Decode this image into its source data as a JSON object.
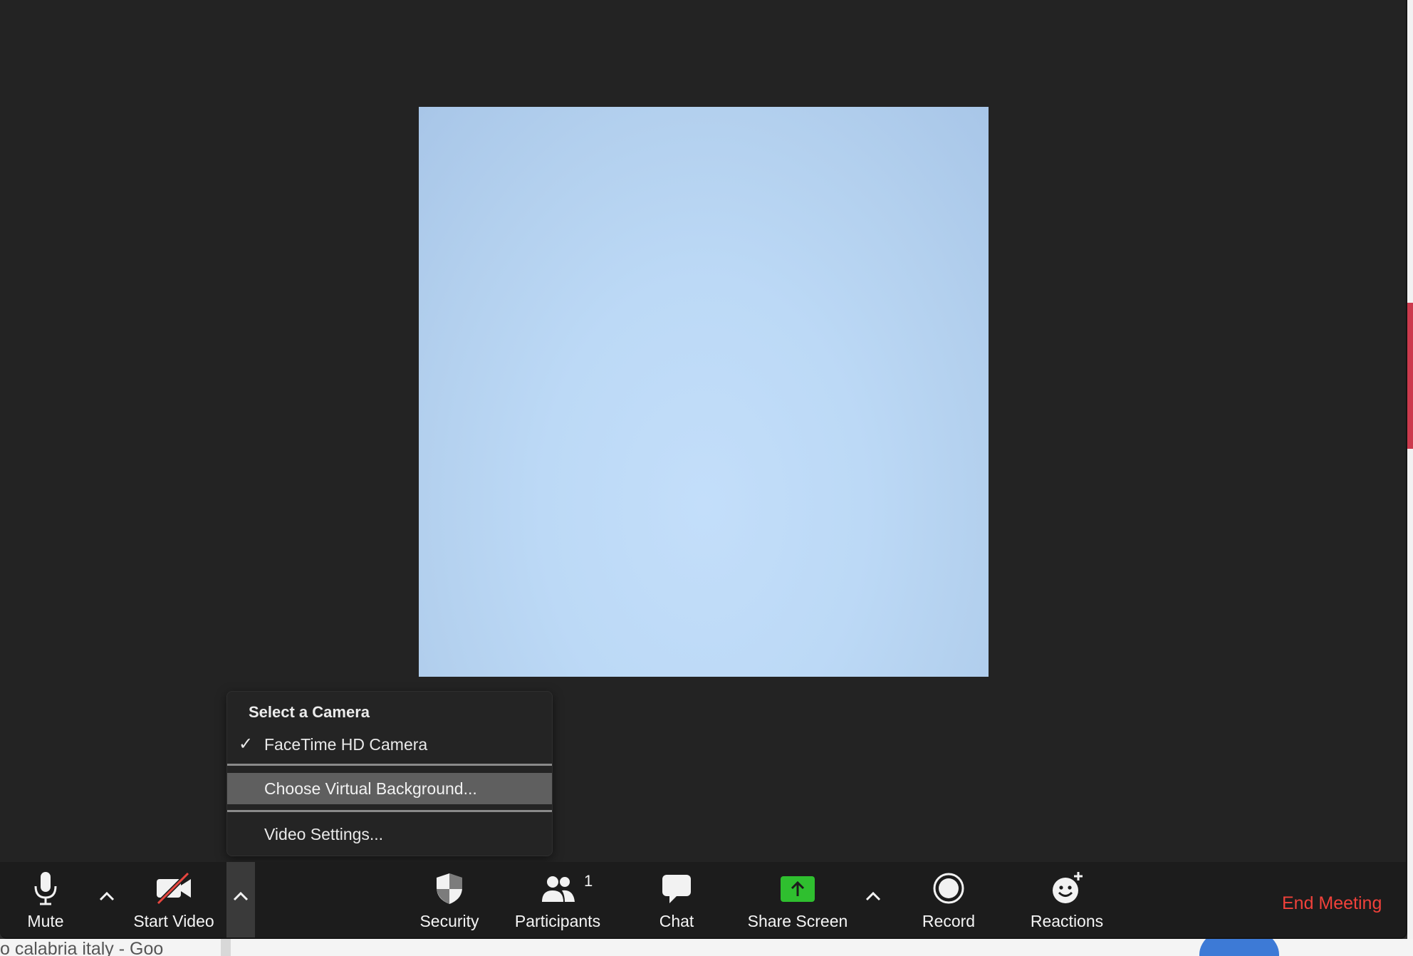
{
  "camera_menu": {
    "heading": "Select a Camera",
    "selected_check": "✓",
    "camera_name": "FaceTime HD Camera",
    "virtual_background": "Choose Virtual Background...",
    "video_settings": "Video Settings..."
  },
  "toolbar": {
    "mute": "Mute",
    "start_video": "Start Video",
    "security": "Security",
    "participants": "Participants",
    "participants_count": "1",
    "chat": "Chat",
    "share_screen": "Share Screen",
    "record": "Record",
    "reactions": "Reactions",
    "end_meeting": "End Meeting"
  },
  "background_window": {
    "tab_text": "o calabria italy - Goo"
  },
  "colors": {
    "end_meeting": "#f0413a",
    "share_screen_green": "#2fbf2f",
    "video_off_red": "#e8463f",
    "video_tile": "#bcd9f6"
  },
  "icons": {
    "mute": "microphone-icon",
    "start_video": "video-off-icon",
    "security": "shield-icon",
    "participants": "people-icon",
    "chat": "chat-bubble-icon",
    "share_screen": "share-screen-icon",
    "record": "record-icon",
    "reactions": "smiley-plus-icon"
  }
}
